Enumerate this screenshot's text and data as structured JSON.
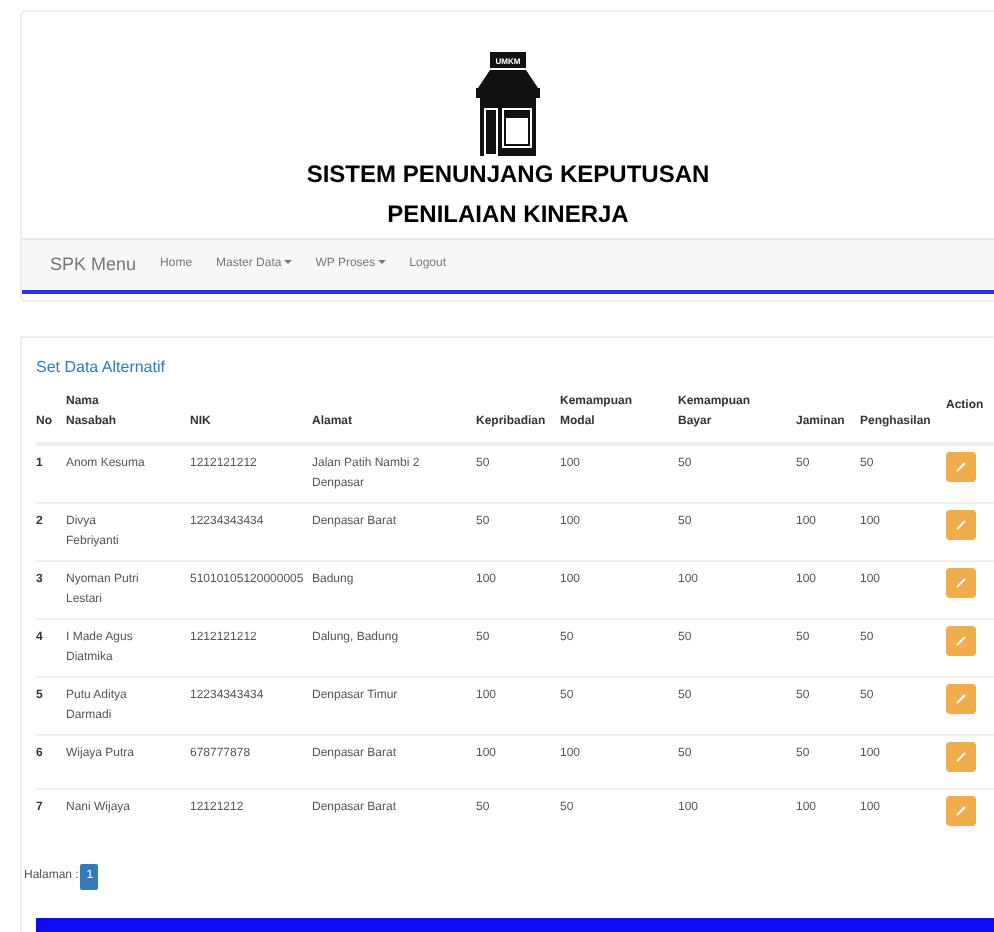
{
  "header": {
    "logo_sign": "UMKM",
    "title_line_1": "SISTEM PENUNJANG KEPUTUSAN",
    "title_line_2": "PENILAIAN KINERJA"
  },
  "navbar": {
    "brand": "SPK Menu",
    "items": [
      {
        "label": "Home",
        "dropdown": false
      },
      {
        "label": "Master Data",
        "dropdown": true
      },
      {
        "label": "WP Proses",
        "dropdown": true
      },
      {
        "label": "Logout",
        "dropdown": false
      }
    ]
  },
  "panel": {
    "title": "Set Data Alternatif"
  },
  "table": {
    "columns": [
      "No",
      "Nama Nasabah",
      "NIK",
      "Alamat",
      "Kepribadian",
      "Kemampuan Modal",
      "Kemampuan Bayar",
      "Jaminan",
      "Penghasilan",
      "Action"
    ],
    "rows": [
      [
        "1",
        "Anom Kesuma",
        "1212121212",
        "Jalan Patih Nambi 2 Denpasar",
        "50",
        "100",
        "50",
        "50",
        "50"
      ],
      [
        "2",
        "Divya Febriyanti",
        "12234343434",
        "Denpasar Barat",
        "50",
        "100",
        "50",
        "100",
        "100"
      ],
      [
        "3",
        "Nyoman Putri Lestari",
        "51010105120000005",
        "Badung",
        "100",
        "100",
        "100",
        "100",
        "100"
      ],
      [
        "4",
        "I Made Agus Diatmika",
        "1212121212",
        "Dalung, Badung",
        "50",
        "50",
        "50",
        "50",
        "50"
      ],
      [
        "5",
        "Putu Aditya Darmadi",
        "12234343434",
        "Denpasar Timur",
        "100",
        "50",
        "50",
        "50",
        "50"
      ],
      [
        "6",
        "Wijaya Putra",
        "678777878",
        "Denpasar Barat",
        "100",
        "100",
        "50",
        "50",
        "100"
      ],
      [
        "7",
        "Nani Wijaya",
        "12121212",
        "Denpasar Barat",
        "50",
        "50",
        "100",
        "100",
        "100"
      ]
    ]
  },
  "pagination": {
    "label": "Halaman :",
    "pages": [
      {
        "label": "1",
        "selected": true
      }
    ]
  }
}
